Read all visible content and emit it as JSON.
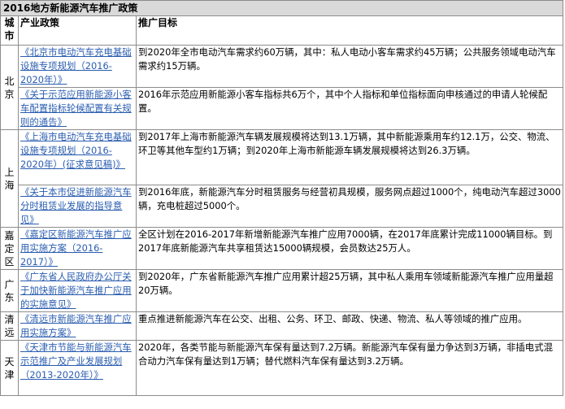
{
  "title": "2016地方新能源汽车推广政策",
  "headers": {
    "city": "城市",
    "policy": "产业政策",
    "goal": "推广目标"
  },
  "rows": [
    {
      "city": "北京",
      "policy": "《北京市电动汽车充电基础设施专项规划（2016-2020年）》",
      "goal": "到2020年全市电动汽车需求约60万辆，其中：私人电动小客车需求约45万辆；公共服务领域电动汽车需求约15万辆。"
    },
    {
      "city": "",
      "policy": "《关于示范应用新能源小客车配置指标轮候配置有关规则的通告》",
      "goal": "2016年示范应用新能源小客车指标共6万个，其中个人指标和单位指标面向申核通过的申请人轮候配置。"
    },
    {
      "city": "上海",
      "policy": "《上海市电动汽车充电基础设施专项规划（2016-2020年）(征求意见稿)》",
      "goal": "到2017年上海市新能源汽车辆发展规模将达到13.1万辆，其中新能源乘用车约12.1万，公交、物流、环卫等其他车型约1万辆；到2020年上海市新能源车辆发展规模将达到26.3万辆。"
    },
    {
      "city": "",
      "policy": "《关于本市促进新能源汽车分时租赁业发展的指导意见》",
      "goal": "到2016年底，新能源汽车分时租赁服务与经营初具规模，服务网点超过1000个，纯电动汽车超过3000辆，充电桩超过5000个。"
    },
    {
      "city": "嘉定区",
      "policy": "《嘉定区新能源汽车推广应用实施方案（2016-2017）》",
      "goal": "全区计划在2016-2017年新增新能源汽车推广应用7000辆，在2017年底累计完成11000辆目标。到2017年底新能源汽车共享租赁达15000辆规模，会员数达25万人。"
    },
    {
      "city": "广东",
      "policy": "《广东省人民政府办公厅关于加快新能源汽车推广应用的实施意见》",
      "goal": "到2020年，广东省新能源汽车推广应用累计超25万辆，其中私人乘用车领域新能源汽车推广应用量超20万辆。"
    },
    {
      "city": "清远",
      "policy": "《清远市新能源汽车推广应用实施方案》",
      "goal": "重点推进新能源汽车在公交、出租、公务、环卫、邮政、快递、物流、私人等领域的推广应用。"
    },
    {
      "city": "天津",
      "policy": "《天津市节能与新能源汽车示范推广及产业发展规划（2013-2020年）》",
      "goal": "2020年，各类节能与新能源汽车保有量达到7.2万辆。新能源汽车保有量力争达到3万辆，非插电式混合动力汽车保有量达到1万辆；替代燃料汽车保有量达到3.2万辆。"
    }
  ]
}
